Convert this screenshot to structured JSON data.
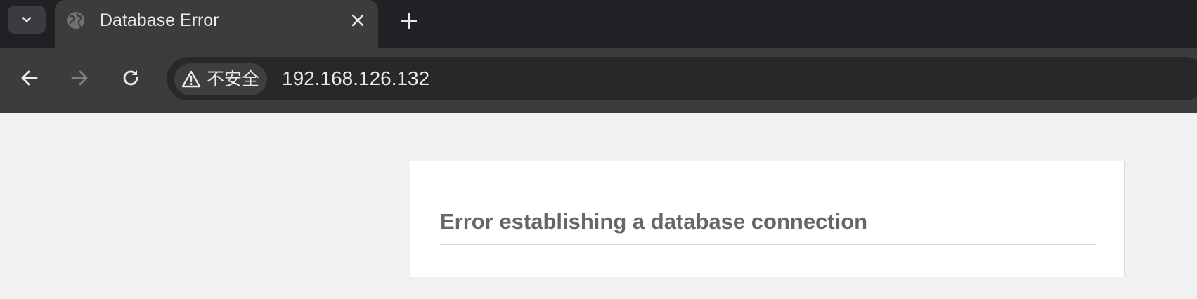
{
  "browser": {
    "tab": {
      "title": "Database Error",
      "favicon": "globe-icon"
    },
    "toolbar": {
      "back_icon": "back-arrow-icon",
      "forward_icon": "forward-arrow-icon",
      "reload_icon": "reload-icon",
      "security_label": "不安全",
      "security_icon": "warning-triangle-icon",
      "url": "192.168.126.132"
    },
    "colors": {
      "tabstrip": "#202124",
      "active_tab": "#3c3c3c",
      "omnibox": "#282828",
      "page_background": "#f1f1f1"
    }
  },
  "page": {
    "error_heading": "Error establishing a database connection",
    "colors": {
      "card_background": "#ffffff",
      "heading_text": "#666666"
    }
  }
}
